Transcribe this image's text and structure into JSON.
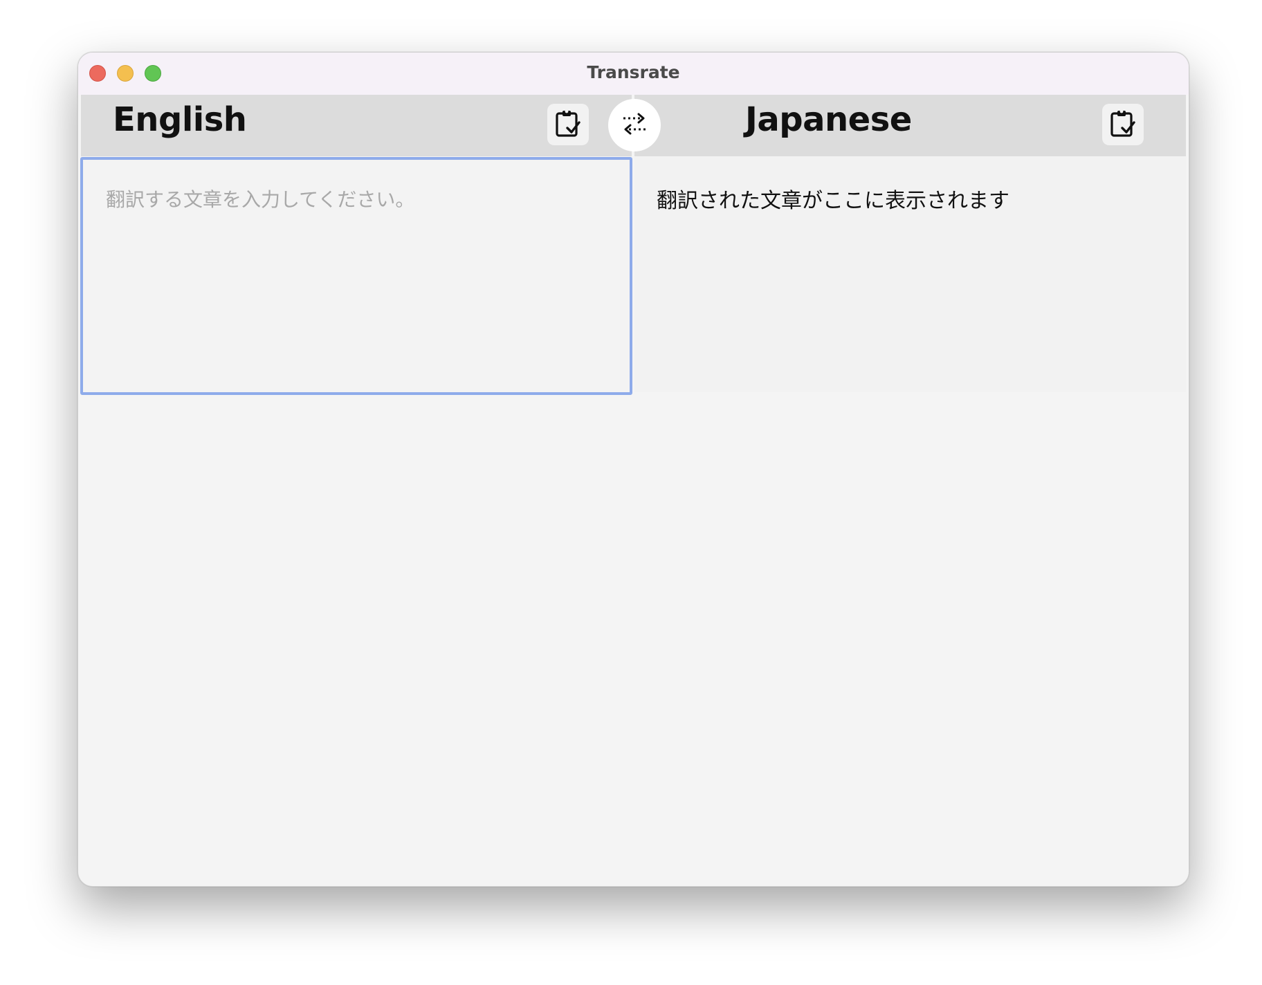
{
  "window": {
    "title": "Transrate"
  },
  "source": {
    "language": "English",
    "placeholder": "翻訳する文章を入力してください。",
    "value": ""
  },
  "target": {
    "language": "Japanese",
    "output": "翻訳された文章がここに表示されます"
  },
  "icons": {
    "paste": "clipboard-check-icon",
    "swap": "swap-arrows-icon"
  },
  "colors": {
    "focus_border": "#8eabea",
    "close": "#ec6a5e",
    "minimize": "#f4bf4f",
    "zoom": "#61c554"
  }
}
